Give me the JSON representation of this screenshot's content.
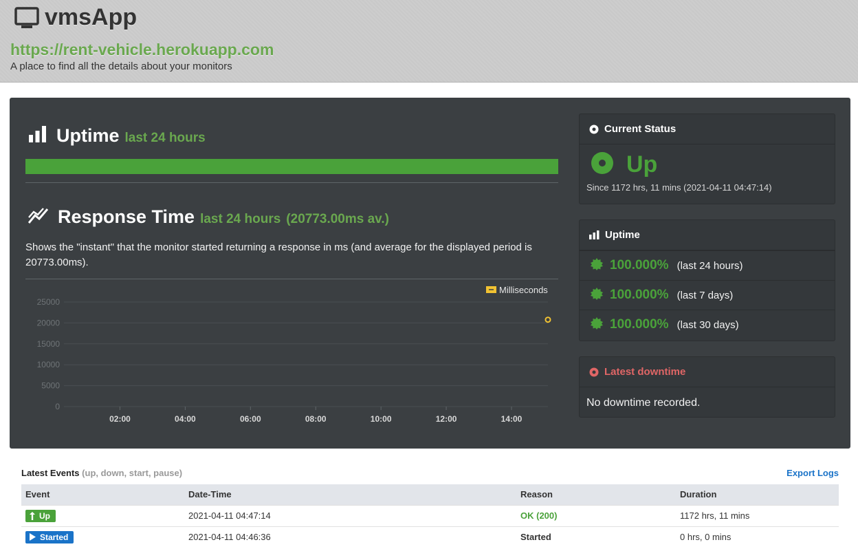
{
  "header": {
    "app_name": "vmsApp",
    "url": "https://rent-vehicle.herokuapp.com",
    "tagline": "A place to find all the details about your monitors",
    "icon": "monitor-icon"
  },
  "uptime_section": {
    "title": "Uptime",
    "period": "last 24 hours",
    "icon": "bar-chart-icon",
    "bar_fraction": 1.0
  },
  "response_section": {
    "title": "Response Time",
    "period": "last 24 hours",
    "average": "(20773.00ms av.)",
    "icon": "line-chart-icon",
    "description": "Shows the \"instant\" that the monitor started returning a response in ms (and average for the displayed period is 20773.00ms)."
  },
  "chart_data": {
    "type": "scatter",
    "title": "",
    "xlabel": "",
    "ylabel": "",
    "legend": "top-right",
    "series": [
      {
        "name": "Milliseconds",
        "x": [
          "15:07"
        ],
        "values": [
          20773
        ]
      }
    ],
    "x_ticks": [
      "02:00",
      "04:00",
      "06:00",
      "08:00",
      "10:00",
      "12:00",
      "14:00"
    ],
    "y_ticks": [
      "0",
      "5000",
      "10000",
      "15000",
      "20000",
      "25000"
    ],
    "ylim": [
      0,
      25000
    ],
    "xlim": [
      "00:17",
      "15:07"
    ],
    "grid": true,
    "color": "#f1c232"
  },
  "current_status": {
    "title": "Current Status",
    "status": "Up",
    "since": "Since 1172 hrs, 11 mins (2021-04-11 04:47:14)",
    "color": "#4aa23a"
  },
  "uptime_card": {
    "title": "Uptime",
    "rows": [
      {
        "pct": "100.000%",
        "period": "(last 24 hours)"
      },
      {
        "pct": "100.000%",
        "period": "(last 7 days)"
      },
      {
        "pct": "100.000%",
        "period": "(last 30 days)"
      }
    ]
  },
  "downtime_card": {
    "title": "Latest downtime",
    "message": "No downtime recorded.",
    "color": "#e06666"
  },
  "events": {
    "title": "Latest Events",
    "subtitle": "(up, down, start, pause)",
    "export_label": "Export Logs",
    "columns": [
      "Event",
      "Date-Time",
      "Reason",
      "Duration"
    ],
    "rows": [
      {
        "event": "Up",
        "datetime": "2021-04-11 04:47:14",
        "reason": "OK (200)",
        "duration": "1172 hrs, 11 mins"
      },
      {
        "event": "Started",
        "datetime": "2021-04-11 04:46:36",
        "reason": "Started",
        "duration": "0 hrs, 0 mins"
      }
    ]
  }
}
